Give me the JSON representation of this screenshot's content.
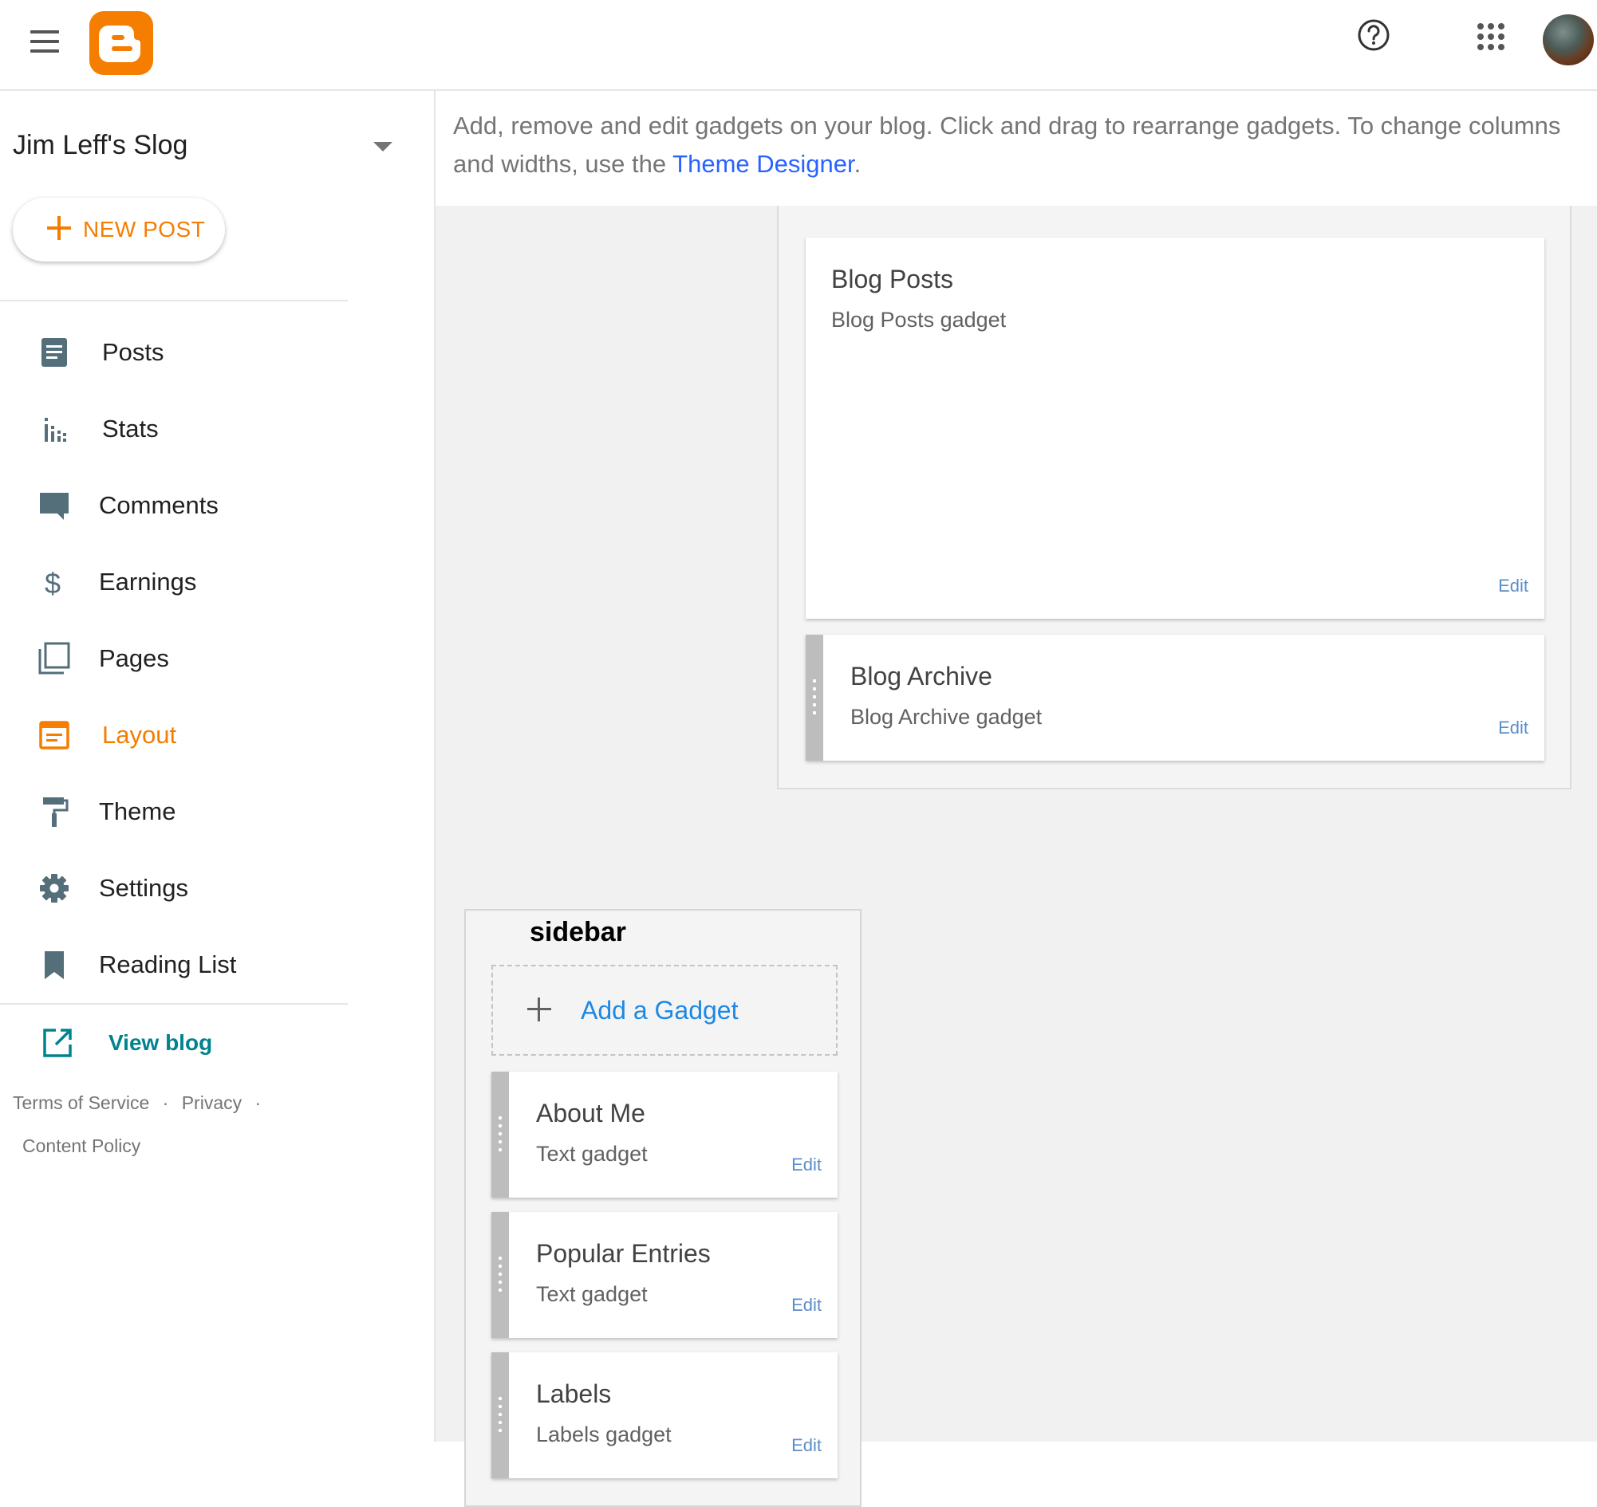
{
  "header": {
    "menu_icon": "hamburger-menu-icon",
    "logo_icon": "blogger-logo-icon",
    "help_icon": "help-circle-icon",
    "apps_icon": "apps-grid-icon",
    "brand_color": "#f57d00"
  },
  "sidebar": {
    "blog_title": "Jim Leff's Slog",
    "new_post_label": "NEW POST",
    "nav": [
      {
        "label": "Posts",
        "icon": "posts-icon"
      },
      {
        "label": "Stats",
        "icon": "stats-icon"
      },
      {
        "label": "Comments",
        "icon": "comments-icon"
      },
      {
        "label": "Earnings",
        "icon": "dollar-icon"
      },
      {
        "label": "Pages",
        "icon": "pages-icon"
      },
      {
        "label": "Layout",
        "icon": "layout-icon",
        "active": true
      },
      {
        "label": "Theme",
        "icon": "paint-roller-icon"
      },
      {
        "label": "Settings",
        "icon": "gear-icon"
      },
      {
        "label": "Reading List",
        "icon": "bookmark-icon"
      }
    ],
    "view_blog_label": "View blog",
    "footer": {
      "terms": "Terms of Service",
      "privacy": "Privacy",
      "content_policy": "Content Policy",
      "separator": "·"
    }
  },
  "main": {
    "intro_text": "Add, remove and edit gadgets on your blog. Click and drag to rearrange gadgets. To change columns and widths, use the ",
    "intro_link": "Theme Designer",
    "intro_end": ".",
    "main_gadgets": [
      {
        "title": "Blog Posts",
        "type": "Blog Posts gadget",
        "edit": "Edit"
      },
      {
        "title": "Blog Archive",
        "type": "Blog Archive gadget",
        "edit": "Edit"
      }
    ],
    "sidebar_section": {
      "title": "sidebar",
      "add_gadget": "Add a Gadget",
      "gadgets": [
        {
          "title": "About Me",
          "type": "Text gadget",
          "edit": "Edit"
        },
        {
          "title": "Popular Entries",
          "type": "Text gadget",
          "edit": "Edit"
        },
        {
          "title": "Labels",
          "type": "Labels gadget",
          "edit": "Edit"
        }
      ]
    }
  }
}
